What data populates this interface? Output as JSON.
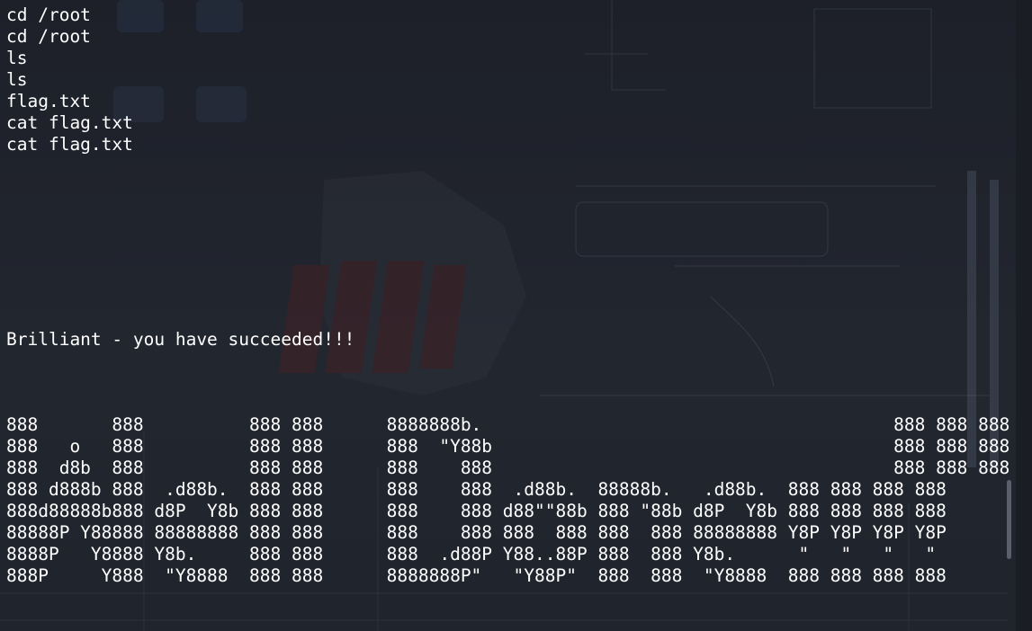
{
  "terminal": {
    "lines": [
      "cd /root",
      "cd /root",
      "ls",
      "ls",
      "flag.txt",
      "cat flag.txt",
      "cat flag.txt",
      "",
      "",
      "",
      "",
      "",
      "",
      "",
      "",
      "Brilliant - you have succeeded!!!",
      "",
      "",
      "",
      "888       888          888 888      8888888b.                                       888 888 888 888",
      "888   o   888          888 888      888  \"Y88b                                      888 888 888 888",
      "888  d8b  888          888 888      888    888                                      888 888 888 888",
      "888 d888b 888  .d88b.  888 888      888    888  .d88b.  88888b.   .d88b.  888 888 888 888",
      "888d88888b888 d8P  Y8b 888 888      888    888 d88\"\"88b 888 \"88b d8P  Y8b 888 888 888 888",
      "88888P Y88888 88888888 888 888      888    888 888  888 888  888 88888888 Y8P Y8P Y8P Y8P",
      "8888P   Y8888 Y8b.     888 888      888  .d88P Y88..88P 888  888 Y8b.      \"   \"   \"   \"",
      "888P     Y888  \"Y8888  888 888      8888888P\"   \"Y88P\"  888  888  \"Y8888  888 888 888 888"
    ]
  }
}
